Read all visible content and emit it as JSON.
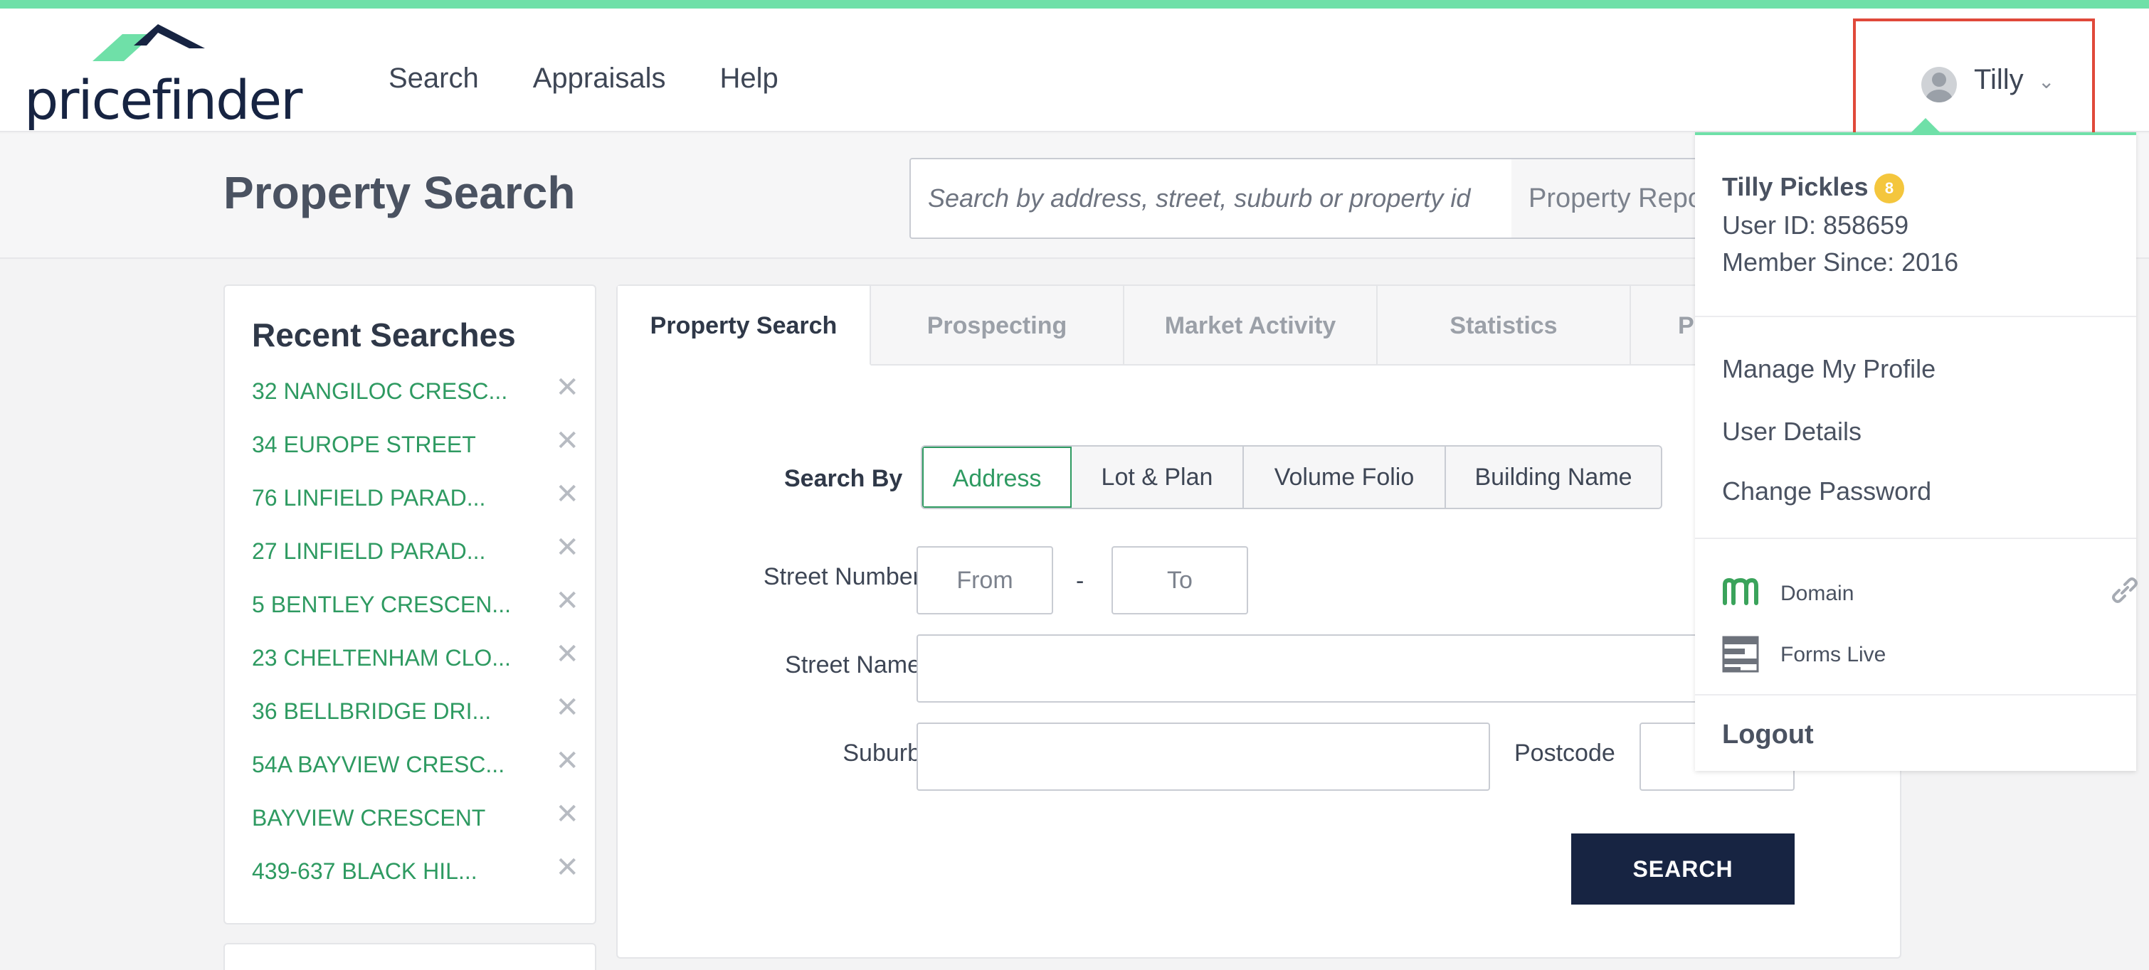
{
  "app": {
    "logo_text": "pricefinder",
    "nav": [
      "Search",
      "Appraisals",
      "Help"
    ],
    "user_short": "Tilly",
    "colors": {
      "accent_green": "#6fe0a8",
      "link_green": "#2e9a61",
      "navy": "#172442",
      "highlight_red": "#e0493a",
      "badge_yellow": "#f4c63d"
    }
  },
  "subheader": {
    "title": "Property Search",
    "search_placeholder": "Search by address, street, suburb or property id",
    "report_select": "Property Report"
  },
  "recent": {
    "title": "Recent Searches",
    "items": [
      "32 NANGILOC CRESC...",
      "34 EUROPE STREET",
      "76 LINFIELD PARAD...",
      "27 LINFIELD PARAD...",
      "5 BENTLEY CRESCEN...",
      "23 CHELTENHAM CLO...",
      "36 BELLBRIDGE DRI...",
      "54A BAYVIEW CRESC...",
      "BAYVIEW CRESCENT",
      "439-637 BLACK HIL..."
    ],
    "remove_icon": "close-icon"
  },
  "tabs": [
    "Property Search",
    "Prospecting",
    "Market Activity",
    "Statistics",
    "P"
  ],
  "form": {
    "search_by_label": "Search By",
    "search_by_options": [
      "Address",
      "Lot & Plan",
      "Volume Folio",
      "Building Name"
    ],
    "street_number_label": "Street Number",
    "from_placeholder": "From",
    "dash": "-",
    "to_placeholder": "To",
    "street_name_label": "Street Name",
    "suburb_label": "Suburb",
    "postcode_label": "Postcode",
    "search_button": "SEARCH"
  },
  "dropdown": {
    "full_name": "Tilly Pickles",
    "badge": "8",
    "user_id": "User ID: 858659",
    "member_since": "Member Since: 2016",
    "links": [
      "Manage My Profile",
      "User Details",
      "Change Password"
    ],
    "apps": [
      "Domain",
      "Forms Live"
    ],
    "logout": "Logout"
  }
}
